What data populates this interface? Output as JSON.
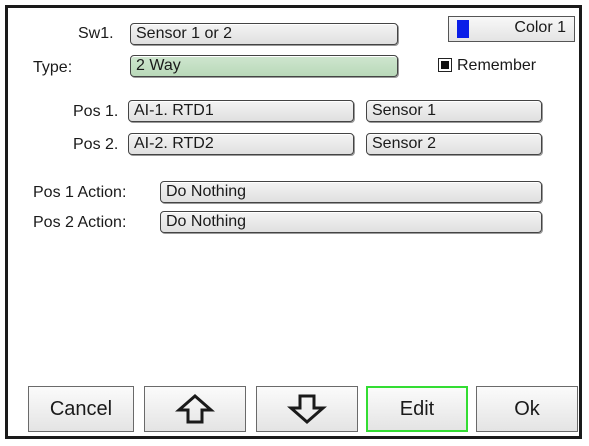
{
  "switch": {
    "label": "Sw1.",
    "value": "Sensor 1 or 2"
  },
  "color": {
    "label": "Color 1",
    "swatch": "#0a1ee8"
  },
  "type": {
    "label": "Type:",
    "value": "2 Way"
  },
  "remember": {
    "label": "Remember",
    "checked": true
  },
  "positions": [
    {
      "label": "Pos 1.",
      "source": "AI-1. RTD1",
      "name": "Sensor 1"
    },
    {
      "label": "Pos 2.",
      "source": "AI-2. RTD2",
      "name": "Sensor 2"
    }
  ],
  "actions": [
    {
      "label": "Pos 1 Action:",
      "value": "Do Nothing"
    },
    {
      "label": "Pos 2 Action:",
      "value": "Do Nothing"
    }
  ],
  "buttons": {
    "cancel": "Cancel",
    "up_icon": "arrow-up-icon",
    "down_icon": "arrow-down-icon",
    "edit": "Edit",
    "ok": "Ok"
  }
}
